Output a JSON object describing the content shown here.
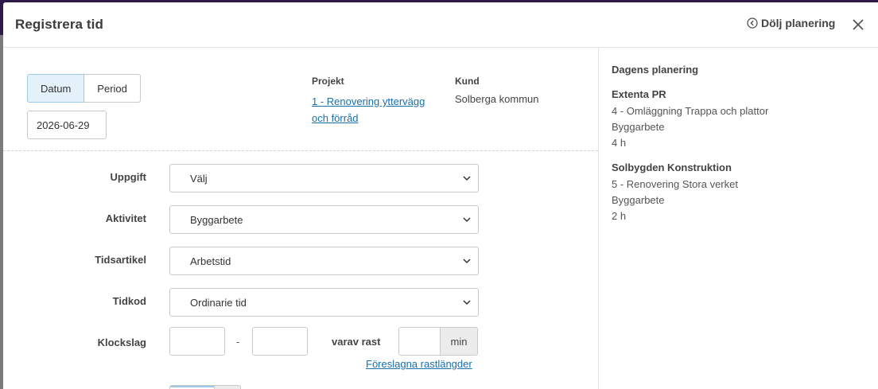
{
  "modal": {
    "title": "Registrera tid",
    "hide_planning_label": "Dölj planering",
    "close_icon": "close-icon"
  },
  "mode_toggle": {
    "options": [
      "Datum",
      "Period"
    ],
    "selected": "Datum"
  },
  "date": {
    "value": "2026-06-29"
  },
  "project": {
    "label": "Projekt",
    "link_text": "1 - Renovering yttervägg och förråd"
  },
  "client": {
    "label": "Kund",
    "name": "Solberga kommun"
  },
  "form": {
    "uppgift": {
      "label": "Uppgift",
      "value": "Välj"
    },
    "aktivitet": {
      "label": "Aktivitet",
      "value": "Byggarbete"
    },
    "tidsartikel": {
      "label": "Tidsartikel",
      "value": "Arbetstid"
    },
    "tidkod": {
      "label": "Tidkod",
      "value": "Ordinarie tid"
    },
    "klockslag": {
      "label": "Klockslag",
      "from_value": "",
      "separator": "-",
      "to_value": "",
      "break_label": "varav rast",
      "break_value": "",
      "break_unit": "min",
      "suggest_link": "Föreslagna rastlängder"
    }
  },
  "planning": {
    "title": "Dagens planering",
    "entries": [
      {
        "client": "Extenta PR",
        "project": "4 - Omläggning Trappa och plattor",
        "activity": "Byggarbete",
        "hours": "4 h"
      },
      {
        "client": "Solbygden Konstruktion",
        "project": "5 - Renovering Stora verket",
        "activity": "Byggarbete",
        "hours": "2 h"
      }
    ]
  },
  "colors": {
    "accent_link": "#1a6fa8",
    "toggle_active_bg": "#e4f1fa",
    "backdrop_bar": "#2e1a47"
  }
}
